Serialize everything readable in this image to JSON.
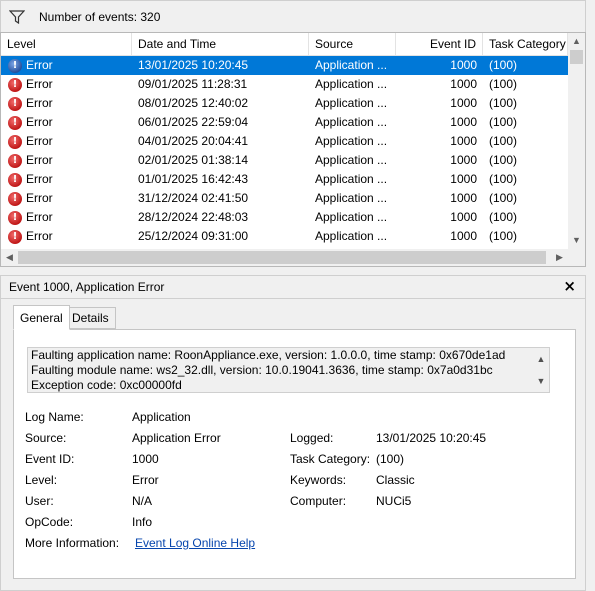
{
  "toolbar": {
    "filter_icon": "filter-icon",
    "event_count": "Number of events: 320"
  },
  "grid": {
    "columns": [
      "Level",
      "Date and Time",
      "Source",
      "Event ID",
      "Task Category"
    ],
    "rows": [
      {
        "level": "Error",
        "date": "13/01/2025 10:20:45",
        "source": "Application ...",
        "id": "1000",
        "cat": "(100)"
      },
      {
        "level": "Error",
        "date": "09/01/2025 11:28:31",
        "source": "Application ...",
        "id": "1000",
        "cat": "(100)"
      },
      {
        "level": "Error",
        "date": "08/01/2025 12:40:02",
        "source": "Application ...",
        "id": "1000",
        "cat": "(100)"
      },
      {
        "level": "Error",
        "date": "06/01/2025 22:59:04",
        "source": "Application ...",
        "id": "1000",
        "cat": "(100)"
      },
      {
        "level": "Error",
        "date": "04/01/2025 20:04:41",
        "source": "Application ...",
        "id": "1000",
        "cat": "(100)"
      },
      {
        "level": "Error",
        "date": "02/01/2025 01:38:14",
        "source": "Application ...",
        "id": "1000",
        "cat": "(100)"
      },
      {
        "level": "Error",
        "date": "01/01/2025 16:42:43",
        "source": "Application ...",
        "id": "1000",
        "cat": "(100)"
      },
      {
        "level": "Error",
        "date": "31/12/2024 02:41:50",
        "source": "Application ...",
        "id": "1000",
        "cat": "(100)"
      },
      {
        "level": "Error",
        "date": "28/12/2024 22:48:03",
        "source": "Application ...",
        "id": "1000",
        "cat": "(100)"
      },
      {
        "level": "Error",
        "date": "25/12/2024 09:31:00",
        "source": "Application ...",
        "id": "1000",
        "cat": "(100)"
      }
    ],
    "selected_row": 0
  },
  "detail": {
    "title": "Event 1000, Application Error",
    "close_label": "×",
    "tabs": [
      "General",
      "Details"
    ],
    "message_lines": [
      "Faulting application name: RoonAppliance.exe, version: 1.0.0.0, time stamp: 0x670de1ad",
      "Faulting module name: ws2_32.dll, version: 10.0.19041.3636, time stamp: 0x7a0d31bc",
      "Exception code: 0xc00000fd"
    ],
    "fields": {
      "log_name_label": "Log Name:",
      "log_name": "Application",
      "source_label": "Source:",
      "source": "Application Error",
      "logged_label": "Logged:",
      "logged": "13/01/2025 10:20:45",
      "event_id_label": "Event ID:",
      "event_id": "1000",
      "task_category_label": "Task Category:",
      "task_category": "(100)",
      "level_label": "Level:",
      "level": "Error",
      "keywords_label": "Keywords:",
      "keywords": "Classic",
      "user_label": "User:",
      "user": "N/A",
      "computer_label": "Computer:",
      "computer": "NUCi5",
      "opcode_label": "OpCode:",
      "opcode": "Info",
      "more_info_label": "More Information:",
      "more_info_link": "Event Log Online Help"
    }
  },
  "colors": {
    "selection": "#0078d7",
    "link": "#0645ad",
    "error": "#c01818"
  }
}
